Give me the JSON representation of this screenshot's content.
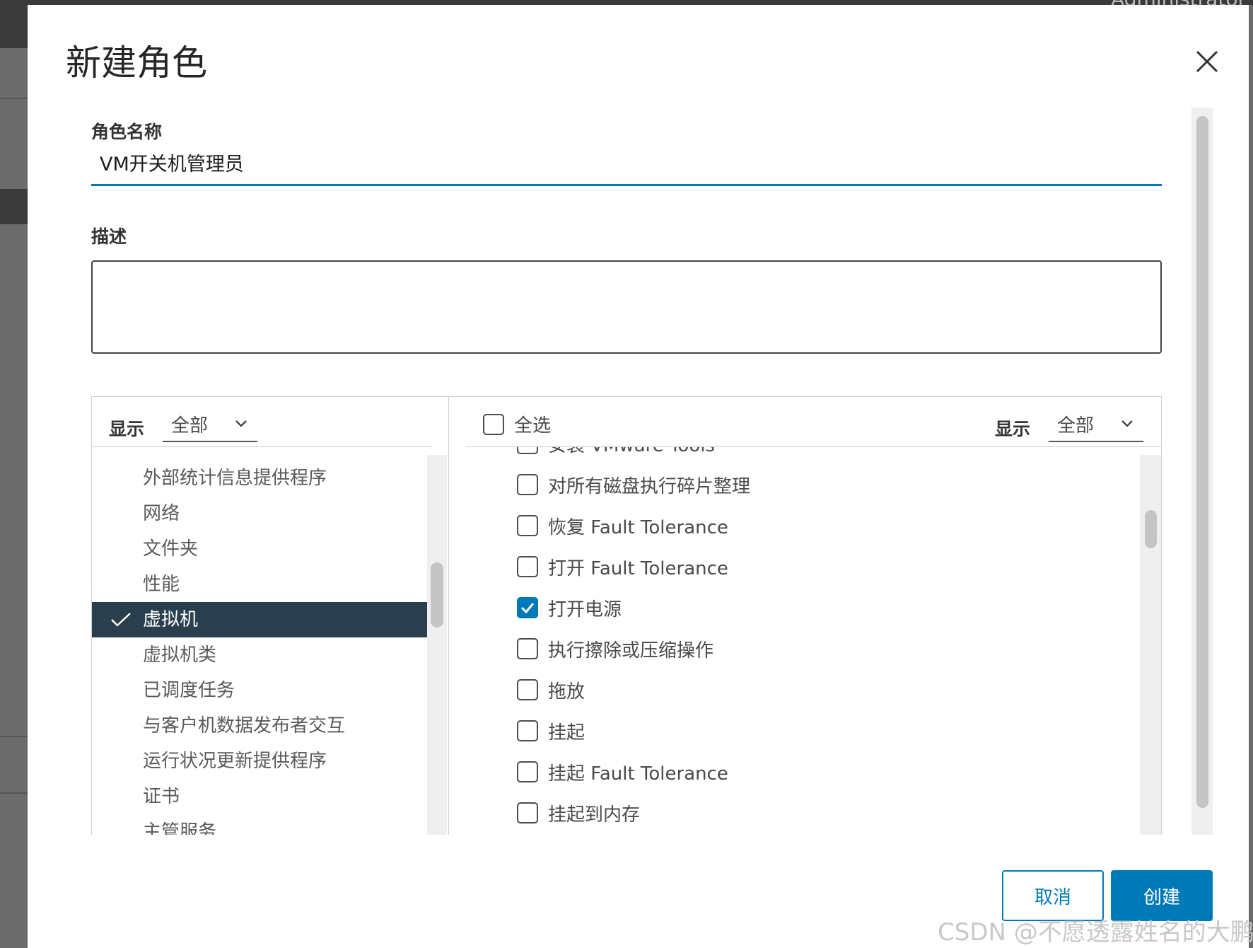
{
  "background": {
    "window_title": "Administrator"
  },
  "dialog": {
    "title": "新建角色",
    "role_name_label": "角色名称",
    "role_name_value": "VM开关机管理员",
    "description_label": "描述",
    "description_value": ""
  },
  "categories": {
    "show_label": "显示",
    "filter_value": "全部",
    "items": [
      {
        "label": "外部统计信息提供程序",
        "selected": false
      },
      {
        "label": "网络",
        "selected": false
      },
      {
        "label": "文件夹",
        "selected": false
      },
      {
        "label": "性能",
        "selected": false
      },
      {
        "label": "虚拟机",
        "selected": true
      },
      {
        "label": "虚拟机类",
        "selected": false
      },
      {
        "label": "已调度任务",
        "selected": false
      },
      {
        "label": "与客户机数据发布者交互",
        "selected": false
      },
      {
        "label": "运行状况更新提供程序",
        "selected": false
      },
      {
        "label": "证书",
        "selected": false
      },
      {
        "label": "主管服务",
        "selected": false
      }
    ]
  },
  "privileges": {
    "select_all_label": "全选",
    "show_label": "显示",
    "filter_value": "全部",
    "items": [
      {
        "label": "安装 VMware Tools",
        "checked": false
      },
      {
        "label": "对所有磁盘执行碎片整理",
        "checked": false
      },
      {
        "label": "恢复 Fault Tolerance",
        "checked": false
      },
      {
        "label": "打开 Fault Tolerance",
        "checked": false
      },
      {
        "label": "打开电源",
        "checked": true
      },
      {
        "label": "执行擦除或压缩操作",
        "checked": false
      },
      {
        "label": "拖放",
        "checked": false
      },
      {
        "label": "挂起",
        "checked": false
      },
      {
        "label": "挂起 Fault Tolerance",
        "checked": false
      },
      {
        "label": "挂起到内存",
        "checked": false
      }
    ]
  },
  "buttons": {
    "cancel": "取消",
    "create": "创建"
  },
  "watermark": "CSDN @不愿透露姓名的大鹏",
  "colors": {
    "accent": "#0079b8",
    "selected_bg": "#293f4d"
  }
}
